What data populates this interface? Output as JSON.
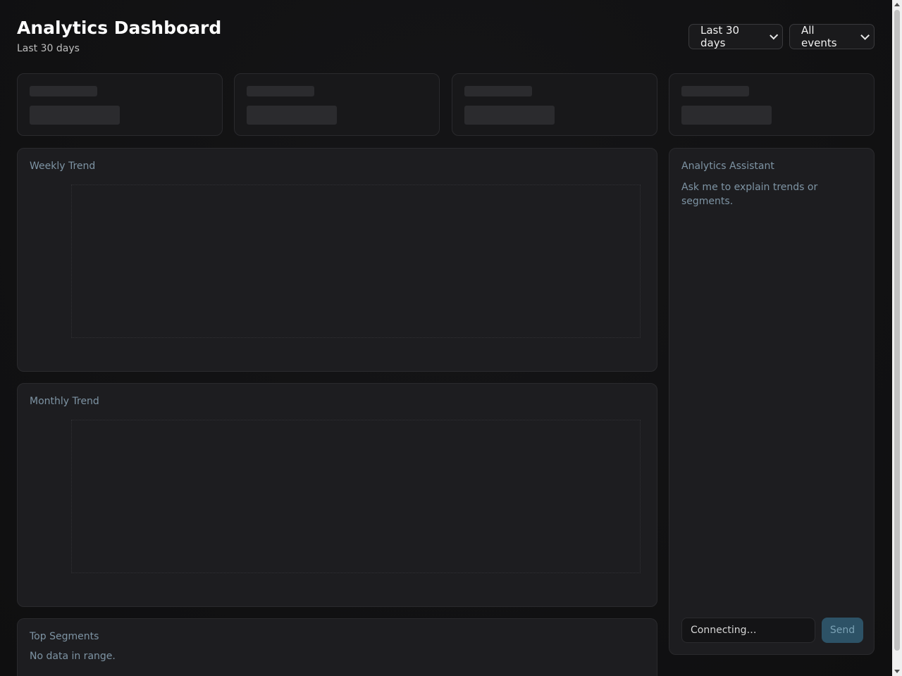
{
  "header": {
    "title": "Analytics Dashboard",
    "subtitle": "Last 30 days"
  },
  "filters": {
    "range": {
      "selected": "Last 30 days",
      "icon": "chevron-down-icon"
    },
    "events": {
      "selected": "All events",
      "icon": "chevron-down-icon"
    }
  },
  "kpis": [
    {
      "state": "loading"
    },
    {
      "state": "loading"
    },
    {
      "state": "loading"
    },
    {
      "state": "loading"
    }
  ],
  "weekly_trend": {
    "title": "Weekly Trend"
  },
  "monthly_trend": {
    "title": "Monthly Trend"
  },
  "top_segments": {
    "title": "Top Segments",
    "empty_text": "No data in range."
  },
  "assistant": {
    "title": "Analytics Assistant",
    "hint": "Ask me to explain trends or segments.",
    "input_placeholder": "Connecting…",
    "send_label": "Send"
  },
  "colors": {
    "background": "#111113",
    "card": "#1d1d20",
    "muted_text": "#7e94a4",
    "send_button": "#2d5266"
  }
}
